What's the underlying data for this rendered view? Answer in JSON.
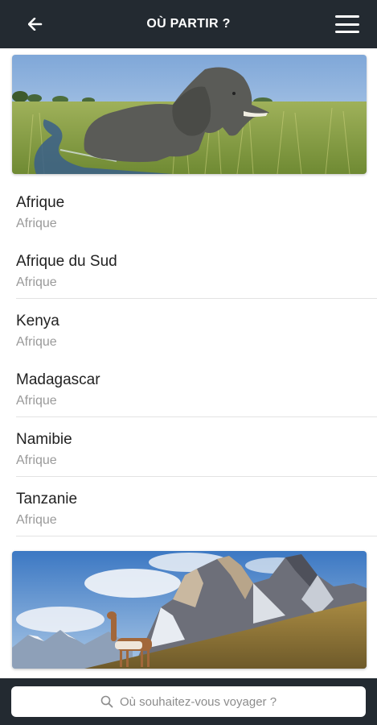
{
  "header": {
    "title": "OÙ PARTIR ?",
    "back_icon": "arrow-left-icon",
    "menu_icon": "hamburger-menu-icon"
  },
  "banners": {
    "top": "elephant-savanna-image",
    "bottom": "patagonia-guanaco-mountains-image"
  },
  "destinations": [
    {
      "name": "Afrique",
      "region": "Afrique"
    },
    {
      "name": "Afrique du Sud",
      "region": "Afrique"
    },
    {
      "name": "Kenya",
      "region": "Afrique"
    },
    {
      "name": "Madagascar",
      "region": "Afrique"
    },
    {
      "name": "Namibie",
      "region": "Afrique"
    },
    {
      "name": "Tanzanie",
      "region": "Afrique"
    }
  ],
  "search": {
    "placeholder": "Où souhaitez-vous voyager ?",
    "icon": "search-icon"
  },
  "colors": {
    "header_bg": "#232a31",
    "text_primary": "#222222",
    "text_secondary": "#9a9a9a"
  }
}
